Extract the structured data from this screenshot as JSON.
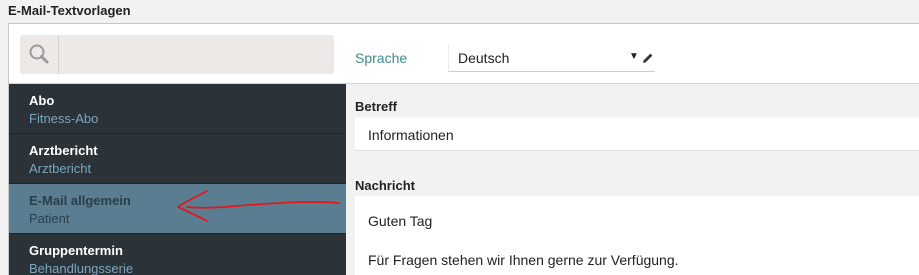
{
  "page": {
    "title": "E-Mail-Textvorlagen"
  },
  "search": {
    "placeholder": "",
    "value": ""
  },
  "language": {
    "label": "Sprache",
    "selected": "Deutsch"
  },
  "sidebar": {
    "items": [
      {
        "title": "Abo",
        "subtitle": "Fitness-Abo"
      },
      {
        "title": "Arztbericht",
        "subtitle": "Arztbericht"
      },
      {
        "title": "E-Mail allgemein",
        "subtitle": "Patient"
      },
      {
        "title": "Gruppentermin",
        "subtitle": "Behandlungsserie"
      }
    ],
    "active_index": 2
  },
  "editor": {
    "subject_label": "Betreff",
    "subject_value": "Informationen",
    "message_label": "Nachricht",
    "message_lines": [
      "Guten Tag",
      "Für Fragen stehen wir Ihnen gerne zur Verfügung."
    ]
  },
  "colors": {
    "sidebar_bg": "#2c3338",
    "sidebar_active": "#5a7d91",
    "accent": "#3d8d8f",
    "annotation": "#e0191b"
  }
}
